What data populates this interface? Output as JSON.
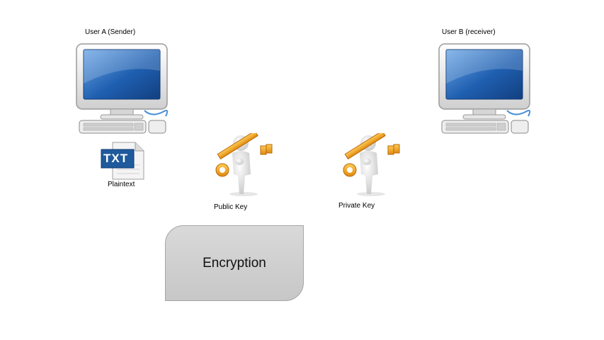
{
  "diagram": {
    "sender_label": "User A (Sender)",
    "receiver_label": "User B (receiver)",
    "plaintext_label": "Plaintext",
    "file_badge": "TXT",
    "public_key_label": "Public Key",
    "private_key_label": "Private Key",
    "process_label": "Encryption"
  },
  "icons": {
    "sender": "computer-icon",
    "receiver": "computer-icon",
    "file": "txt-file-icon",
    "public_key": "person-holding-key-icon",
    "private_key": "person-holding-key-icon"
  },
  "colors": {
    "screen_blue": "#1f5fb0",
    "key_orange": "#f0a020",
    "file_badge_blue": "#1e5a9c",
    "process_box": "#d0d0d0"
  }
}
